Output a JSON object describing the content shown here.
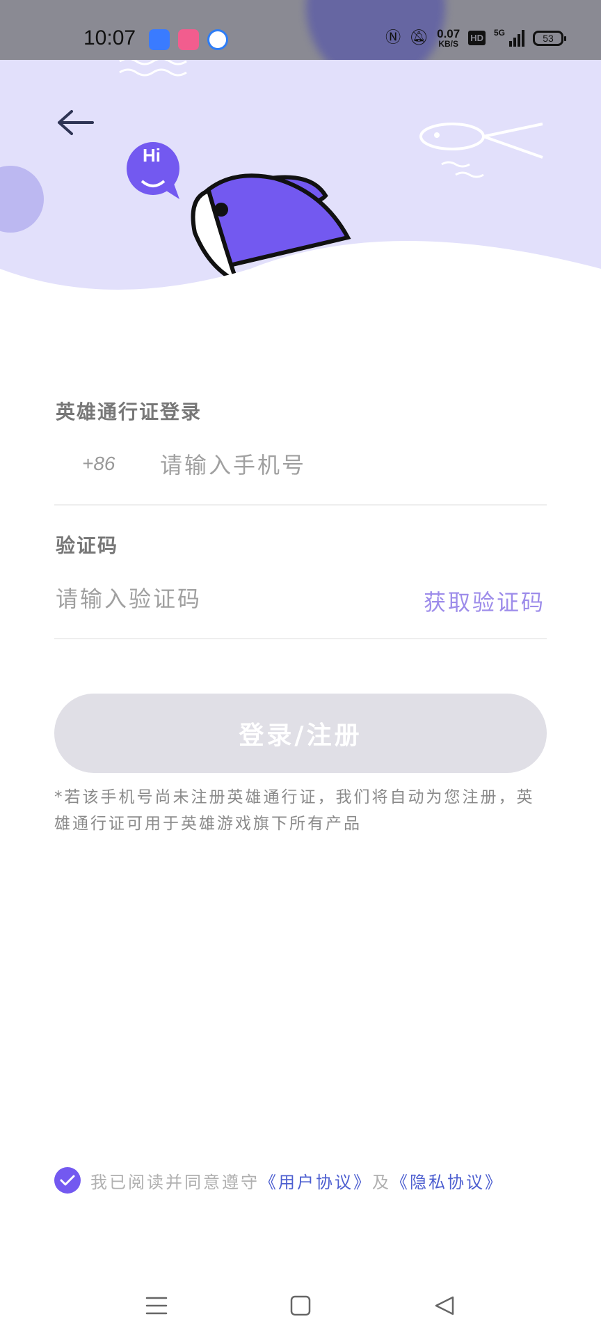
{
  "status_bar": {
    "time": "10:07",
    "net_speed_value": "0.07",
    "net_speed_unit": "KB/S",
    "hd_label": "HD",
    "network_label": "5G",
    "battery_level": "53"
  },
  "header": {
    "hi_bubble_text": "Hi"
  },
  "login": {
    "title": "英雄通行证登录",
    "country_code": "+86",
    "phone_placeholder": "请输入手机号",
    "code_title": "验证码",
    "code_placeholder": "请输入验证码",
    "get_code_label": "获取验证码",
    "submit_label": "登录/注册",
    "notice": "*若该手机号尚未注册英雄通行证，我们将自动为您注册，英雄通行证可用于英雄游戏旗下所有产品"
  },
  "agreement": {
    "checked": true,
    "prefix": "我已阅读并同意遵守",
    "user_agreement": "《用户协议》",
    "separator": "及",
    "privacy_agreement": "《隐私协议》"
  },
  "colors": {
    "accent": "#7359f0",
    "header_bg": "#e2e0fb",
    "link": "#4d5fd0",
    "button_disabled": "#e0dfe6"
  },
  "icons": {
    "back": "arrow-left-icon",
    "nav_menu": "menu-icon",
    "nav_home": "square-icon",
    "nav_back": "triangle-back-icon",
    "check": "check-icon"
  }
}
